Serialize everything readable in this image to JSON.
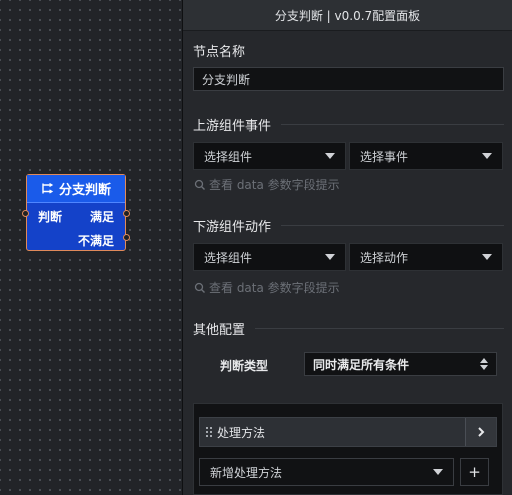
{
  "canvas": {
    "node": {
      "title": "分支判断",
      "input_label": "判断",
      "output_true": "满足",
      "output_false": "不满足"
    }
  },
  "panel": {
    "title": "分支判断 | v0.0.7配置面板",
    "node_name": {
      "label": "节点名称",
      "value": "分支判断"
    },
    "upstream": {
      "label": "上游组件事件",
      "component_select": "选择组件",
      "event_select": "选择事件",
      "hint": "查看 data 参数字段提示"
    },
    "downstream": {
      "label": "下游组件动作",
      "component_select": "选择组件",
      "action_select": "选择动作",
      "hint": "查看 data 参数字段提示"
    },
    "other": {
      "label": "其他配置",
      "judge_type_label": "判断类型",
      "judge_type_value": "同时满足所有条件"
    },
    "methods": {
      "item_label": "处理方法",
      "add_select": "新增处理方法",
      "add_button": "+"
    }
  },
  "colors": {
    "node_body": "#1442c9",
    "node_header": "#1a5bea",
    "node_border": "#e08a5a",
    "panel_bg": "#26282c",
    "select_bg": "#0f1012"
  }
}
